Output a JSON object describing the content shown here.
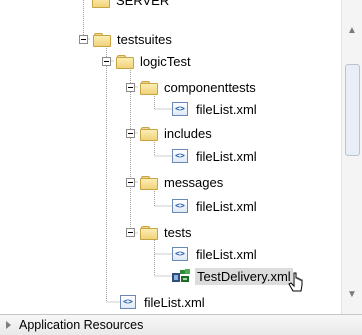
{
  "tree": {
    "items": [
      {
        "label": "SERVER",
        "icon": "folder-icon"
      },
      {
        "label": "testsuites",
        "icon": "folder-icon"
      },
      {
        "label": "logicTest",
        "icon": "folder-icon"
      },
      {
        "label": "componenttests",
        "icon": "folder-icon"
      },
      {
        "label": "fileList.xml",
        "icon": "xml-file-icon"
      },
      {
        "label": "includes",
        "icon": "folder-icon"
      },
      {
        "label": "fileList.xml",
        "icon": "xml-file-icon"
      },
      {
        "label": "messages",
        "icon": "folder-icon"
      },
      {
        "label": "fileList.xml",
        "icon": "xml-file-icon"
      },
      {
        "label": "tests",
        "icon": "folder-icon"
      },
      {
        "label": "fileList.xml",
        "icon": "xml-file-icon"
      },
      {
        "label": "TestDelivery.xml",
        "icon": "test-delivery-icon"
      },
      {
        "label": "fileList.xml",
        "icon": "xml-file-icon"
      }
    ],
    "xml_glyph": "<>"
  },
  "footer": {
    "label": "Application Resources"
  },
  "colors": {
    "selection": "#dcdcdc",
    "folder": "#f0d27a",
    "tree_line": "#a0a0a0"
  }
}
